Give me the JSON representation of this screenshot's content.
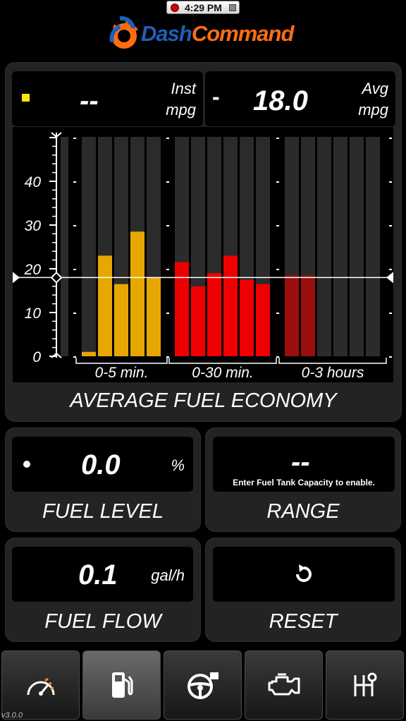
{
  "status_bar": {
    "time": "4:29 PM"
  },
  "app": {
    "logo_part1": "Dash",
    "logo_part2": "Command",
    "version": "v3.0.0"
  },
  "fuel_economy": {
    "inst_value": "--",
    "inst_unit_line1": "Inst",
    "inst_unit_line2": "mpg",
    "avg_sign": "-",
    "avg_value": "18.0",
    "avg_unit_line1": "Avg",
    "avg_unit_line2": "mpg",
    "title": "AVERAGE FUEL ECONOMY"
  },
  "chart_data": {
    "type": "bar",
    "yticks": [
      "40",
      "30",
      "20",
      "10",
      "0"
    ],
    "ylim": [
      0,
      50
    ],
    "average_line": 18.0,
    "groups": [
      {
        "label": "0-5 min.",
        "color": "#e6a800",
        "values": [
          1,
          23,
          16.5,
          28.5,
          18
        ]
      },
      {
        "label": "0-30 min.",
        "color": "#ee0000",
        "values": [
          21.5,
          16,
          19,
          23,
          17.5,
          16.5
        ]
      },
      {
        "label": "0-3 hours",
        "color": "#9a0e0e",
        "values": [
          18.5,
          18.5,
          0,
          0,
          0,
          0
        ]
      }
    ]
  },
  "fuel_level": {
    "value": "0.0",
    "unit": "%",
    "label": "FUEL LEVEL"
  },
  "range": {
    "value": "--",
    "note": "Enter Fuel Tank Capacity to enable.",
    "label": "RANGE"
  },
  "fuel_flow": {
    "value": "0.1",
    "unit": "gal/h",
    "label": "FUEL FLOW"
  },
  "reset": {
    "label": "RESET"
  },
  "nav": {
    "items": [
      {
        "name": "gauge-icon"
      },
      {
        "name": "fuel-pump-icon"
      },
      {
        "name": "steering-wheel-icon"
      },
      {
        "name": "engine-icon"
      },
      {
        "name": "gear-shifter-icon"
      }
    ]
  }
}
